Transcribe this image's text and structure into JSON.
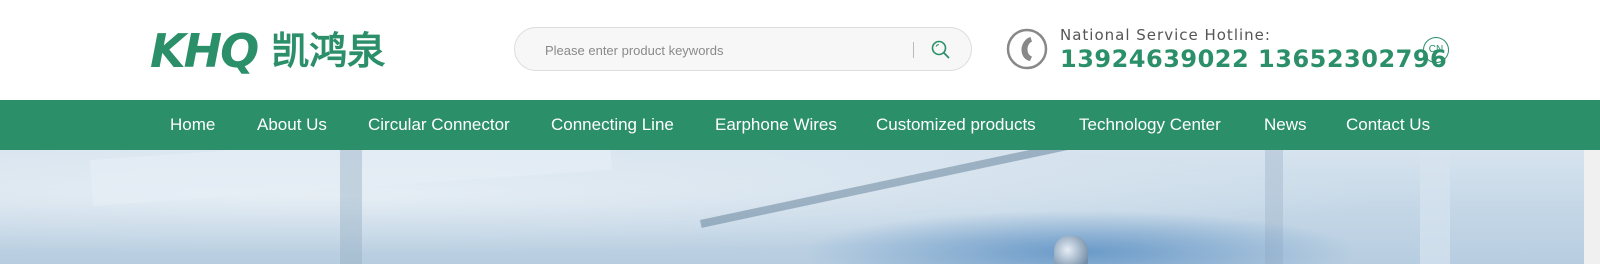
{
  "brand": {
    "logo_mark": "KHQ",
    "logo_cn": "凯鸿泉",
    "color": "#2b8f6a"
  },
  "search": {
    "placeholder": "Please enter product keywords",
    "icon": "search-icon"
  },
  "contact": {
    "icon": "phone-icon",
    "hotline_label": "National Service Hotline:",
    "hotline_numbers": "13924639022 13652302796"
  },
  "language": {
    "label": "CN"
  },
  "nav": {
    "items": [
      {
        "label": "Home"
      },
      {
        "label": "About Us"
      },
      {
        "label": "Circular Connector"
      },
      {
        "label": "Connecting Line"
      },
      {
        "label": "Earphone Wires"
      },
      {
        "label": "Customized products"
      },
      {
        "label": "Technology Center"
      },
      {
        "label": "News"
      },
      {
        "label": "Contact Us"
      }
    ]
  }
}
